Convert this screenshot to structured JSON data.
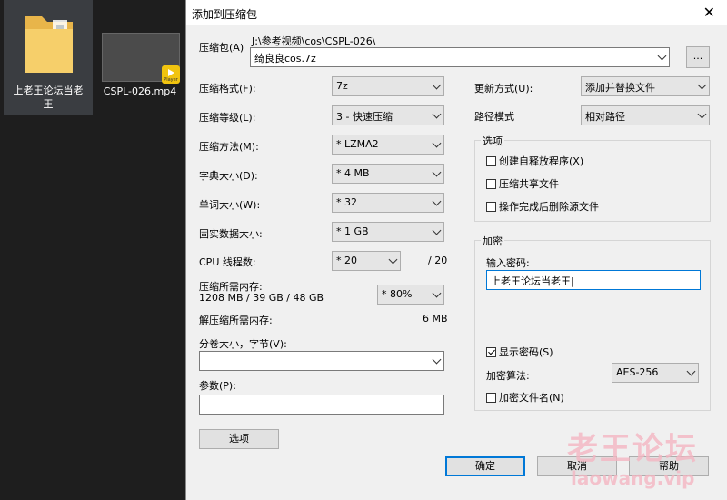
{
  "desktop": {
    "folder_label": "上老王论坛当老王",
    "video_label": "CSPL-026.mp4",
    "video_badge": "Player"
  },
  "dialog": {
    "title": "添加到压缩包",
    "close_glyph": "✕",
    "archive": {
      "label": "压缩包(A)",
      "path": "J:\\参考视频\\cos\\CSPL-026\\",
      "name": "绮良良cos.7z",
      "browse_label": "..."
    },
    "left": {
      "format": {
        "label": "压缩格式(F):",
        "value": "7z"
      },
      "level": {
        "label": "压缩等级(L):",
        "value": "3 - 快速压缩"
      },
      "method": {
        "label": "压缩方法(M):",
        "value": "* LZMA2"
      },
      "dict": {
        "label": "字典大小(D):",
        "value": "* 4 MB"
      },
      "word": {
        "label": "单词大小(W):",
        "value": "* 32"
      },
      "solid": {
        "label": "固实数据大小:",
        "value": "* 1 GB"
      },
      "threads": {
        "label": "CPU 线程数:",
        "value": "* 20",
        "max": "/ 20"
      },
      "mem": {
        "label": "压缩所需内存:",
        "detail": "1208 MB / 39 GB / 48 GB",
        "value": "* 80%"
      },
      "decomp": {
        "label": "解压缩所需内存:",
        "value": "6 MB"
      },
      "volume": {
        "label": "分卷大小，字节(V):",
        "value": ""
      },
      "params": {
        "label": "参数(P):",
        "value": ""
      },
      "options_btn": "选项"
    },
    "right": {
      "update": {
        "label": "更新方式(U):",
        "value": "添加并替换文件"
      },
      "pathmode": {
        "label": "路径模式",
        "value": "相对路径"
      },
      "options": {
        "title": "选项",
        "sfx": {
          "label": "创建自释放程序(X)",
          "checked": false
        },
        "shared": {
          "label": "压缩共享文件",
          "checked": false
        },
        "delete": {
          "label": "操作完成后删除源文件",
          "checked": false
        }
      },
      "encryption": {
        "title": "加密",
        "pw_label": "输入密码:",
        "password": "上老王论坛当老王",
        "show_pw": {
          "label": "显示密码(S)",
          "checked": true
        },
        "algo_label": "加密算法:",
        "algo": "AES-256",
        "encnames": {
          "label": "加密文件名(N)",
          "checked": false
        }
      }
    },
    "buttons": {
      "ok": "确定",
      "cancel": "取消",
      "help": "帮助"
    }
  },
  "watermark": {
    "cn": "老王论坛",
    "en": "laowang.vip"
  }
}
